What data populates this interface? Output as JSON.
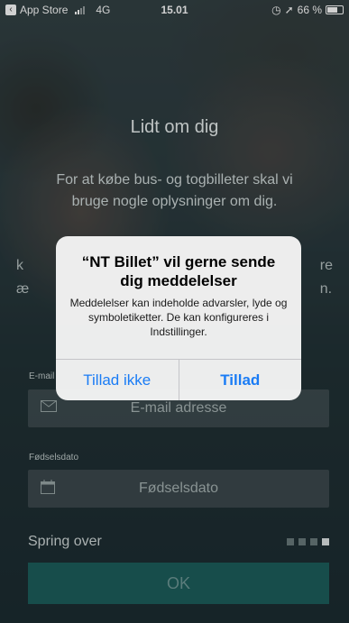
{
  "status_bar": {
    "back_app": "App Store",
    "network": "4G",
    "time": "15.01",
    "battery_percent": "66 %",
    "battery_level": 0.66,
    "icons": [
      "back-arrow-icon",
      "signal-icon",
      "alarm-icon",
      "location-arrow-icon",
      "battery-icon"
    ]
  },
  "screen": {
    "title": "Lidt om dig",
    "subtitle": "For at købe bus- og togbilleter skal vi bruge nogle oplysninger om dig.",
    "partial_left": "k\næ",
    "partial_right": "re\nn."
  },
  "form": {
    "email": {
      "label": "E-mail",
      "placeholder": "E-mail adresse",
      "value": ""
    },
    "birthdate": {
      "label": "Fødselsdato",
      "placeholder": "Fødselsdato",
      "value": ""
    }
  },
  "footer": {
    "skip_label": "Spring over",
    "page_dots": 4,
    "active_dot": 4,
    "ok_label": "OK"
  },
  "alert": {
    "title": "“NT Billet” vil gerne sende dig meddelelser",
    "message": "Meddelelser kan indeholde advarsler, lyde og symboletiketter. De kan konfigureres i Indstillinger.",
    "deny_label": "Tillad ikke",
    "allow_label": "Tillad"
  },
  "colors": {
    "accent_button": "#1d5e5c",
    "alert_button_text": "#1a7cf5"
  }
}
